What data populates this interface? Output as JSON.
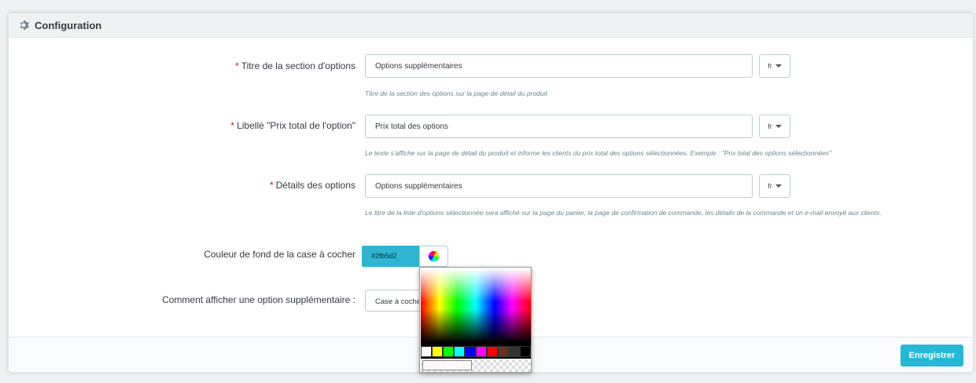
{
  "panel": {
    "title": "Configuration",
    "title_icon": "gear-icon"
  },
  "fields": [
    {
      "label": "Titre de la section d'options",
      "required": "*",
      "value": "Options supplémentaires",
      "lang": "fr",
      "help": "Titre de la section des options sur la page de détail du produit"
    },
    {
      "label": "Libellé \"Prix total de l'option\"",
      "required": "*",
      "value": "Prix total des options",
      "lang": "fr",
      "help": "Le texte s'affiche sur la page de détail du produit et informe les clients du prix total des options sélectionnées. Exemple : \"Prix total des options sélectionnées\""
    },
    {
      "label": "Détails des options",
      "required": "*",
      "value": "Options supplémentaires",
      "lang": "fr",
      "help": "Le titre de la liste d'options sélectionnée sera affiché sur la page du panier, la page de confirmation de commande, les détails de la commande et un e-mail envoyé aux clients."
    }
  ],
  "color_field": {
    "label": "Couleur de fond de la case à cocher",
    "value": "#2fb5d2",
    "accent": "#2fb5d2",
    "icon": "color-wheel-icon"
  },
  "display_field": {
    "label": "Comment afficher une option supplémentaire :",
    "value": "Case à cocher"
  },
  "color_picker": {
    "swatches": [
      "#ffffff",
      "#ffff00",
      "#00ff00",
      "#00ffff",
      "#0000ff",
      "#ff00ff",
      "#ff0000",
      "#663322",
      "#333333",
      "#000000"
    ]
  },
  "footer": {
    "save_label": "Enregistrer",
    "save_color": "#25b9d7"
  }
}
